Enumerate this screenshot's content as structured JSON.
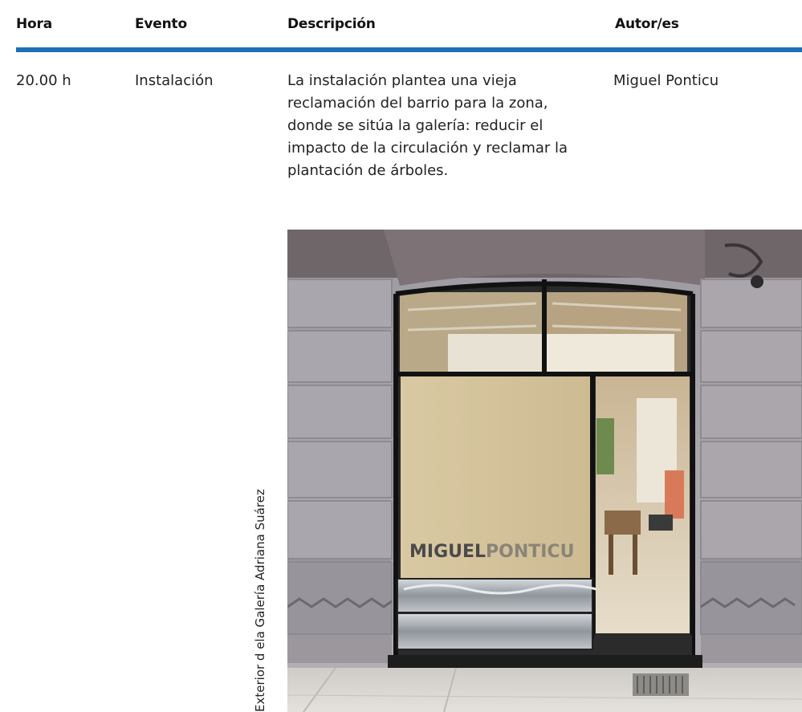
{
  "table": {
    "headers": {
      "hora": "Hora",
      "evento": "Evento",
      "descripcion": "Descripción",
      "autores": "Autor/es"
    },
    "row": {
      "hora": "20.00 h",
      "evento": "Instalación",
      "descripcion": "La instalación plantea una vieja reclamación del barrio para la zona, donde se sitúa la galería: reducir el impacto de la circulación y reclamar la plantación de árboles.",
      "autores": "Miguel Ponticu"
    }
  },
  "photo": {
    "sign_first": "MIGUEL",
    "sign_second": "PONTICU",
    "caption": "Exterior d ela Galería Adriana Suárez"
  },
  "colors": {
    "accent_rule": "#1f6fb6",
    "sign_dark": "#4a4a4a",
    "sign_light": "#8a8478"
  }
}
